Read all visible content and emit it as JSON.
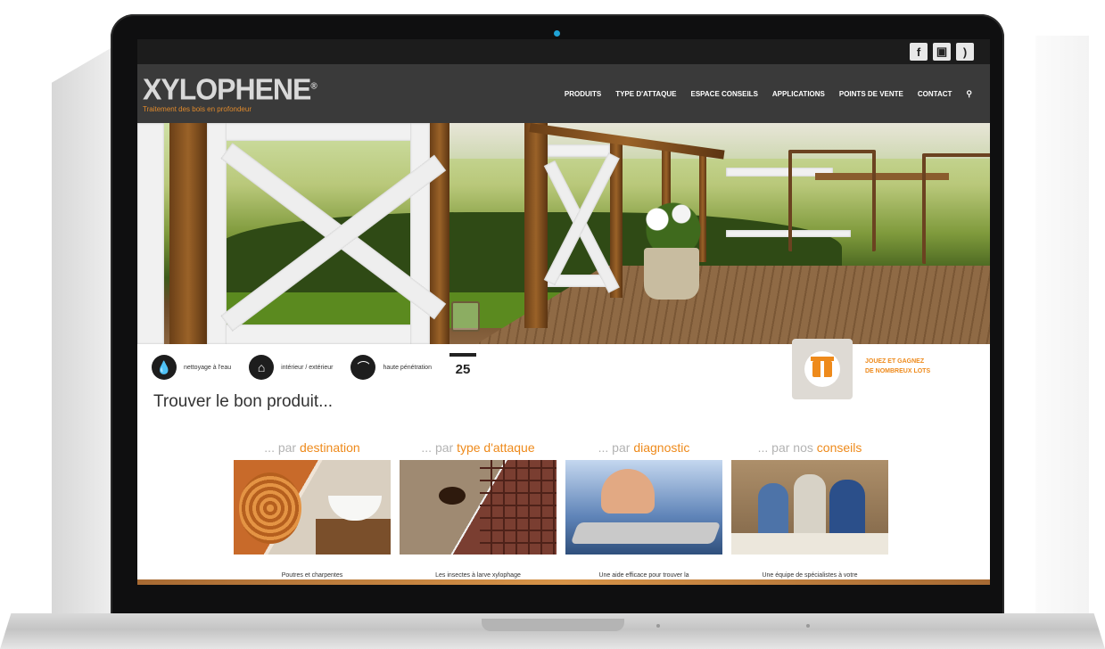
{
  "social": {
    "facebook": "f",
    "youtube": "▣",
    "rss": ")"
  },
  "header": {
    "logo": "XYLOPHENE",
    "registered": "®",
    "tagline": "Traitement des bois en profondeur",
    "nav": [
      "PRODUITS",
      "TYPE D'ATTAQUE",
      "ESPACE CONSEILS",
      "APPLICATIONS",
      "POINTS DE VENTE",
      "CONTACT"
    ],
    "search_icon": "⚲"
  },
  "features": [
    {
      "label": "nettoyage à l'eau",
      "icon": "water-drop-icon"
    },
    {
      "label": "intérieur / extérieur",
      "icon": "house-icon"
    },
    {
      "label": "haute pénétration",
      "icon": "penetration-icon"
    }
  ],
  "years_badge": "25",
  "promo": {
    "line1": "JOUEZ ET GAGNEZ",
    "line2": "DE NOMBREUX LOTS"
  },
  "finder_title": "Trouver le bon produit...",
  "categories": [
    {
      "prefix": "... par ",
      "accent": "destination",
      "desc": "Poutres et charpentes"
    },
    {
      "prefix": "... par ",
      "accent": "type d'attaque",
      "desc": "Les insectes à larve xylophage"
    },
    {
      "prefix": "... par ",
      "accent": "diagnostic",
      "desc": "Une aide efficace pour trouver la"
    },
    {
      "prefix": "... par nos ",
      "accent": "conseils",
      "desc": "Une équipe de spécialistes à votre"
    }
  ],
  "colors": {
    "accent": "#ee8a1b",
    "header_bg": "#3a3a3a",
    "topbar_bg": "#1c1c1c"
  }
}
